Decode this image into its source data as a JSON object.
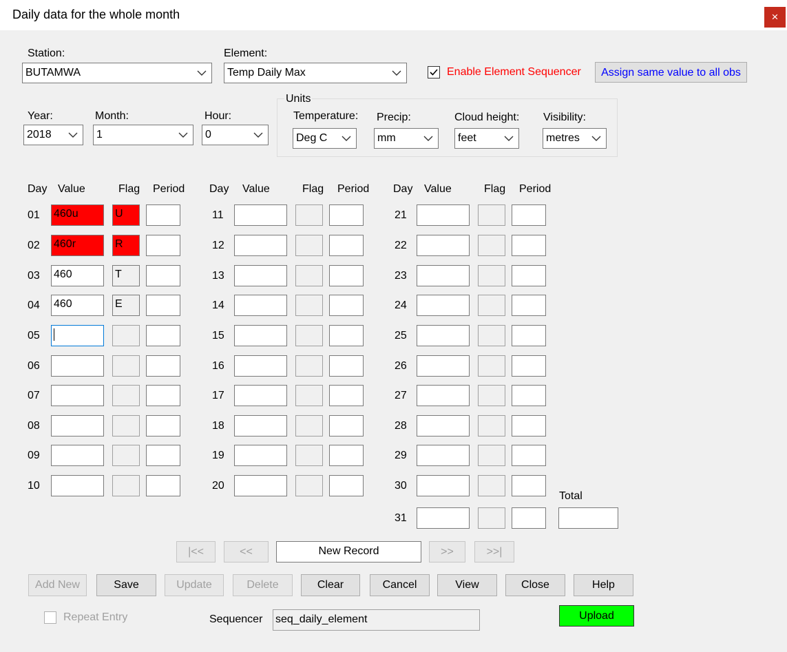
{
  "window": {
    "title": "Daily data for the whole month",
    "close_label": "×"
  },
  "header": {
    "station_label": "Station:",
    "station_value": "BUTAMWA",
    "element_label": "Element:",
    "element_value": "Temp  Daily Max",
    "sequencer_checkbox_label": "Enable Element Sequencer",
    "sequencer_checked": true,
    "assign_button": "Assign same value to all obs",
    "year_label": "Year:",
    "year_value": "2018",
    "month_label": "Month:",
    "month_value": "1",
    "hour_label": "Hour:",
    "hour_value": "0"
  },
  "units": {
    "group_label": "Units",
    "temperature_label": "Temperature:",
    "temperature_value": "Deg C",
    "precip_label": "Precip:",
    "precip_value": "mm",
    "cloud_label": "Cloud height:",
    "cloud_value": "feet",
    "visibility_label": "Visibility:",
    "visibility_value": "metres"
  },
  "columns": {
    "day": "Day",
    "value": "Value",
    "flag": "Flag",
    "period": "Period"
  },
  "rows": [
    {
      "day": "01",
      "value": "460u",
      "flag": "U",
      "period": "",
      "highlight": true
    },
    {
      "day": "02",
      "value": "460r",
      "flag": "R",
      "period": "",
      "highlight": true
    },
    {
      "day": "03",
      "value": "460",
      "flag": "T",
      "period": ""
    },
    {
      "day": "04",
      "value": "460",
      "flag": "E",
      "period": ""
    },
    {
      "day": "05",
      "value": "",
      "flag": "",
      "period": "",
      "focused": true
    },
    {
      "day": "06",
      "value": "",
      "flag": "",
      "period": ""
    },
    {
      "day": "07",
      "value": "",
      "flag": "",
      "period": ""
    },
    {
      "day": "08",
      "value": "",
      "flag": "",
      "period": ""
    },
    {
      "day": "09",
      "value": "",
      "flag": "",
      "period": ""
    },
    {
      "day": "10",
      "value": "",
      "flag": "",
      "period": ""
    },
    {
      "day": "11",
      "value": "",
      "flag": "",
      "period": ""
    },
    {
      "day": "12",
      "value": "",
      "flag": "",
      "period": ""
    },
    {
      "day": "13",
      "value": "",
      "flag": "",
      "period": ""
    },
    {
      "day": "14",
      "value": "",
      "flag": "",
      "period": ""
    },
    {
      "day": "15",
      "value": "",
      "flag": "",
      "period": ""
    },
    {
      "day": "16",
      "value": "",
      "flag": "",
      "period": ""
    },
    {
      "day": "17",
      "value": "",
      "flag": "",
      "period": ""
    },
    {
      "day": "18",
      "value": "",
      "flag": "",
      "period": ""
    },
    {
      "day": "19",
      "value": "",
      "flag": "",
      "period": ""
    },
    {
      "day": "20",
      "value": "",
      "flag": "",
      "period": ""
    },
    {
      "day": "21",
      "value": "",
      "flag": "",
      "period": ""
    },
    {
      "day": "22",
      "value": "",
      "flag": "",
      "period": ""
    },
    {
      "day": "23",
      "value": "",
      "flag": "",
      "period": ""
    },
    {
      "day": "24",
      "value": "",
      "flag": "",
      "period": ""
    },
    {
      "day": "25",
      "value": "",
      "flag": "",
      "period": ""
    },
    {
      "day": "26",
      "value": "",
      "flag": "",
      "period": ""
    },
    {
      "day": "27",
      "value": "",
      "flag": "",
      "period": ""
    },
    {
      "day": "28",
      "value": "",
      "flag": "",
      "period": ""
    },
    {
      "day": "29",
      "value": "",
      "flag": "",
      "period": ""
    },
    {
      "day": "30",
      "value": "",
      "flag": "",
      "period": ""
    },
    {
      "day": "31",
      "value": "",
      "flag": "",
      "period": ""
    }
  ],
  "total": {
    "label": "Total",
    "value": ""
  },
  "navigation": {
    "first": "|<<",
    "prev": "<<",
    "record": "New Record",
    "next": ">>",
    "last": ">>|"
  },
  "actions": {
    "add_new": "Add New",
    "save": "Save",
    "update": "Update",
    "delete": "Delete",
    "clear": "Clear",
    "cancel": "Cancel",
    "view": "View",
    "close": "Close",
    "help": "Help"
  },
  "footer": {
    "repeat_entry_label": "Repeat Entry",
    "repeat_entry_checked": false,
    "sequencer_label": "Sequencer",
    "sequencer_value": "seq_daily_element",
    "upload": "Upload"
  },
  "colors": {
    "flag_error": "#ff0000",
    "upload": "#00ff00",
    "sequencer_text": "#ff0000",
    "assign_text": "#0000ff"
  }
}
